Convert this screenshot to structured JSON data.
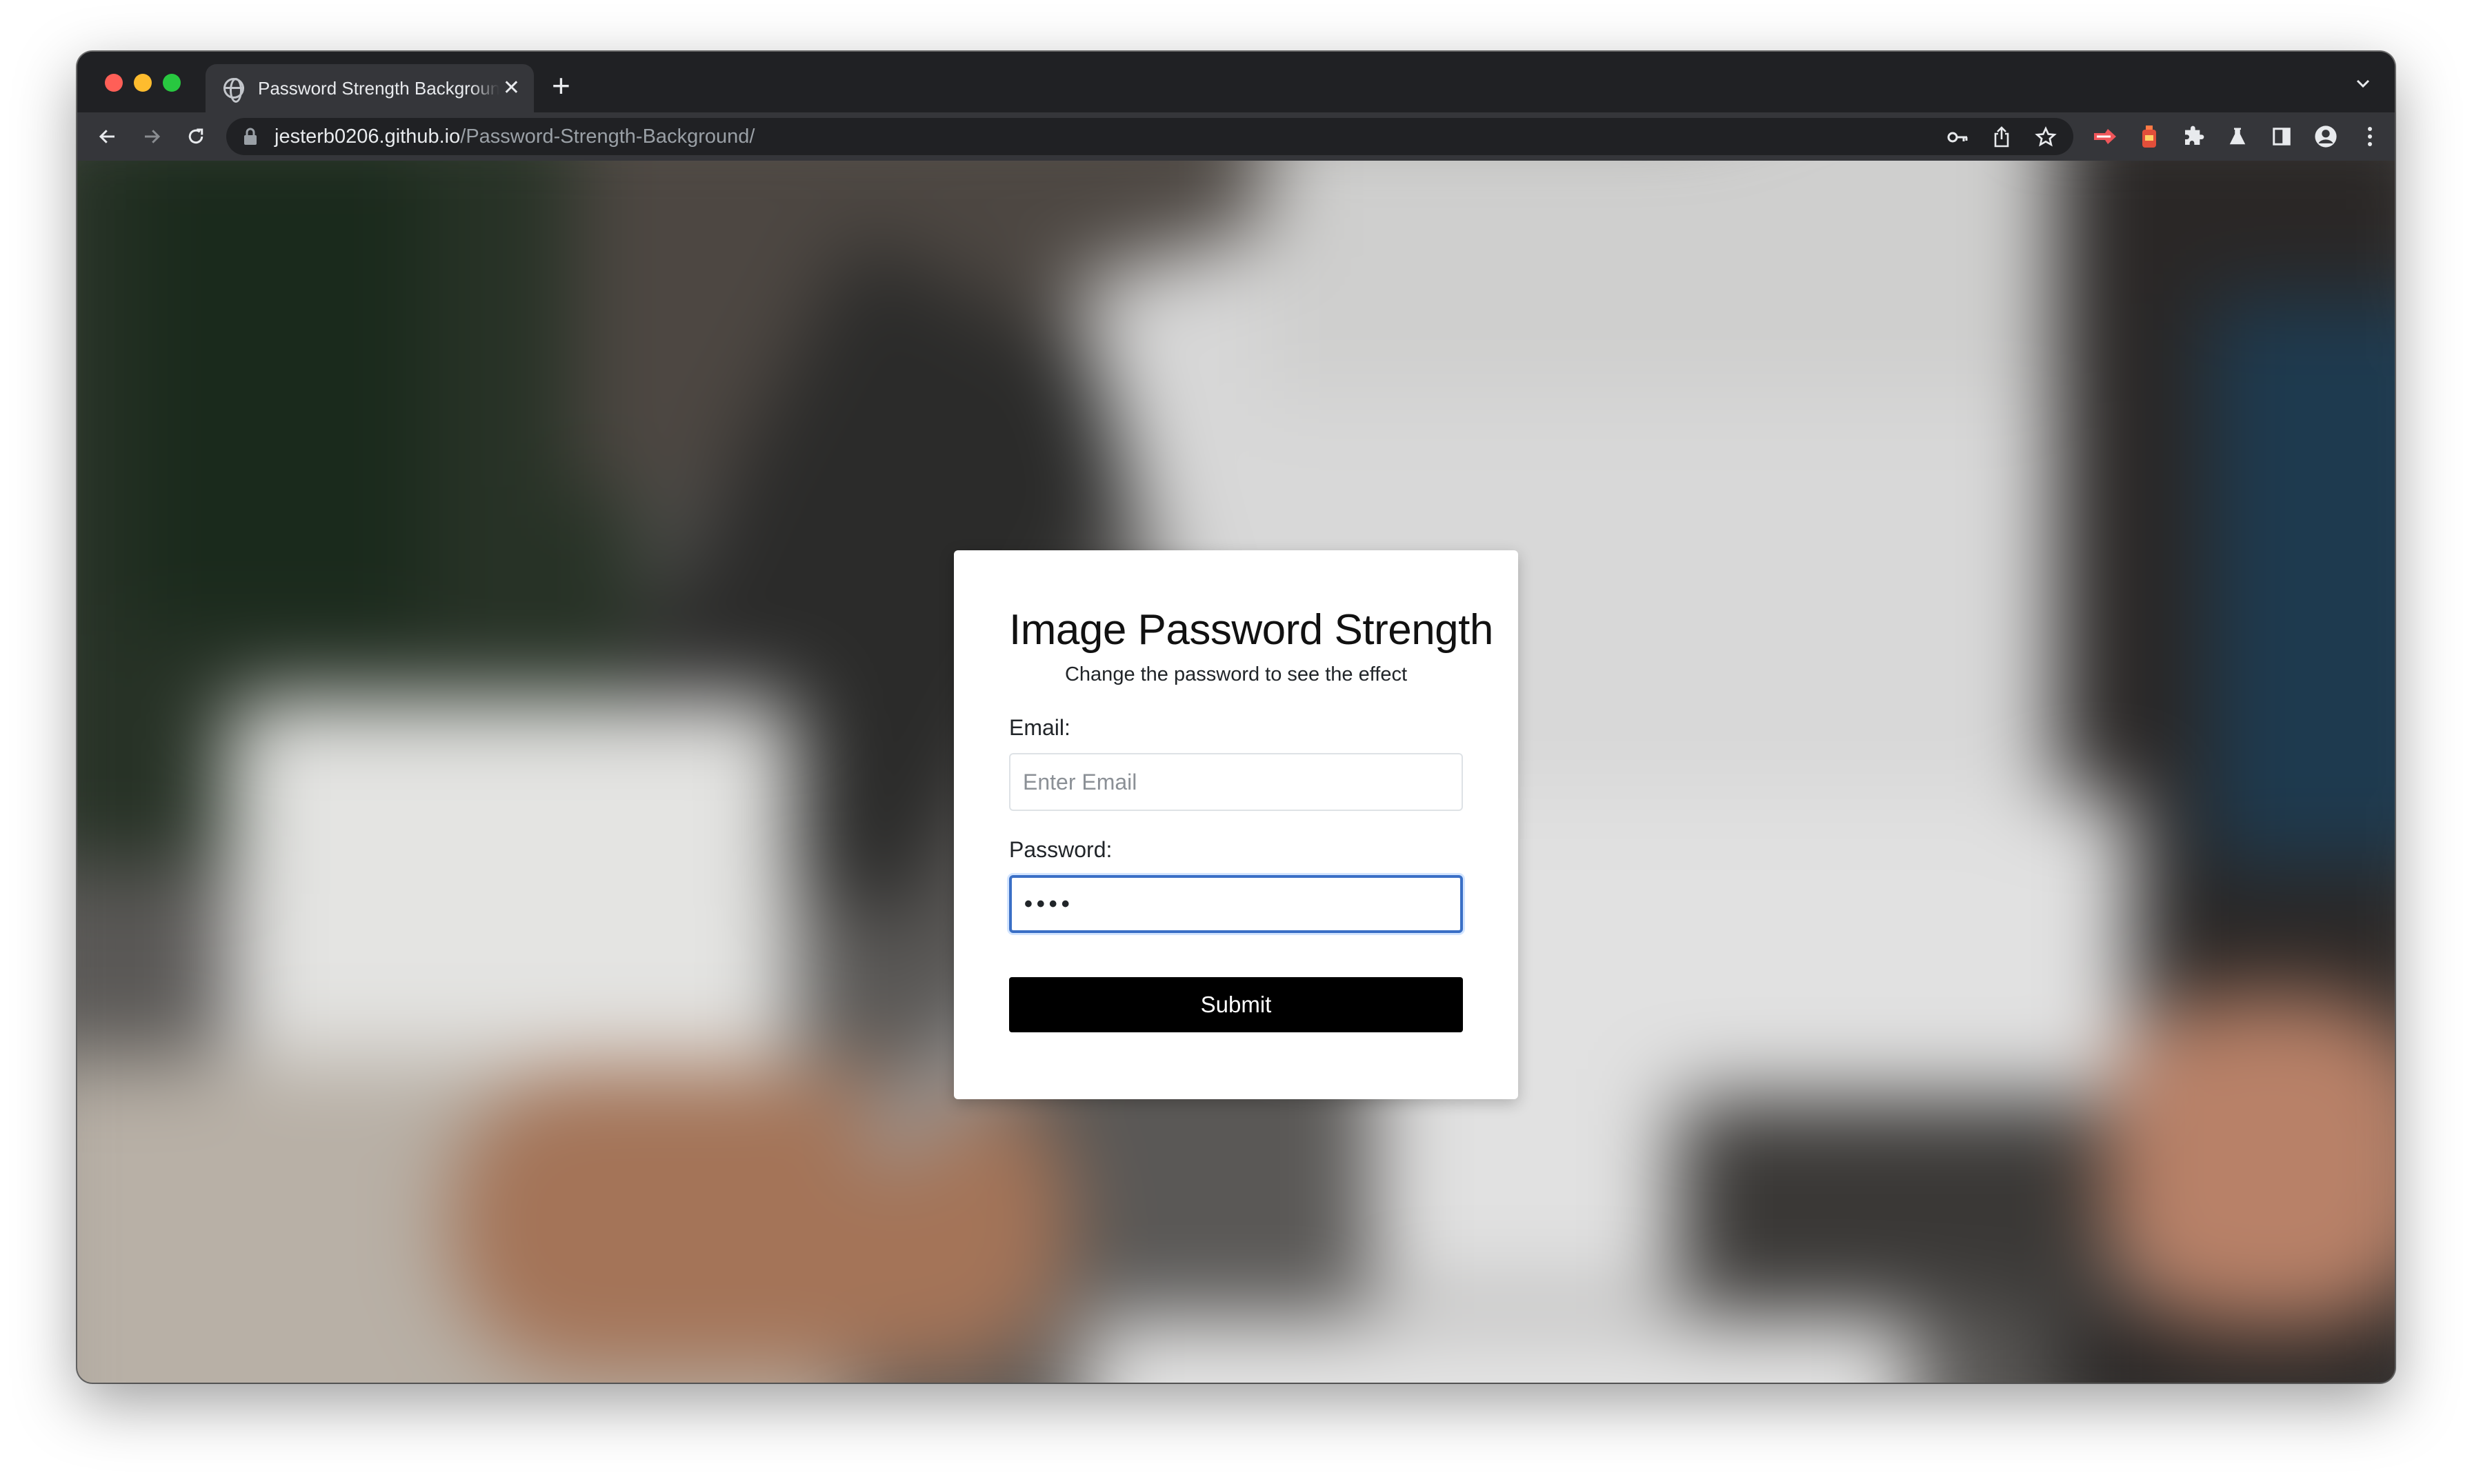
{
  "browser": {
    "tab_title": "Password Strength Background",
    "tab_close": "✕",
    "new_tab": "+",
    "url_host": "jesterb0206.github.io",
    "url_path": "/Password-Strength-Background/",
    "icons": [
      "back-arrow-icon",
      "forward-arrow-icon",
      "reload-icon",
      "lock-icon",
      "key-icon",
      "share-icon",
      "star-icon",
      "extension-red-icon",
      "extension-bottle-icon",
      "puzzle-icon",
      "lab-flask-icon",
      "side-panel-icon",
      "profile-icon",
      "menu-dots-icon",
      "tab-search-chevron-icon"
    ]
  },
  "card": {
    "title": "Image Password Strength",
    "subtitle": "Change the password to see the effect",
    "email_label": "Email:",
    "email_placeholder": "Enter Email",
    "email_value": "",
    "password_label": "Password:",
    "password_value": "••••",
    "submit_label": "Submit"
  },
  "colors": {
    "window_bg": "#202124",
    "toolbar_bg": "#35363a",
    "submit_bg": "#000000",
    "focus_border": "#3a6fc6"
  }
}
